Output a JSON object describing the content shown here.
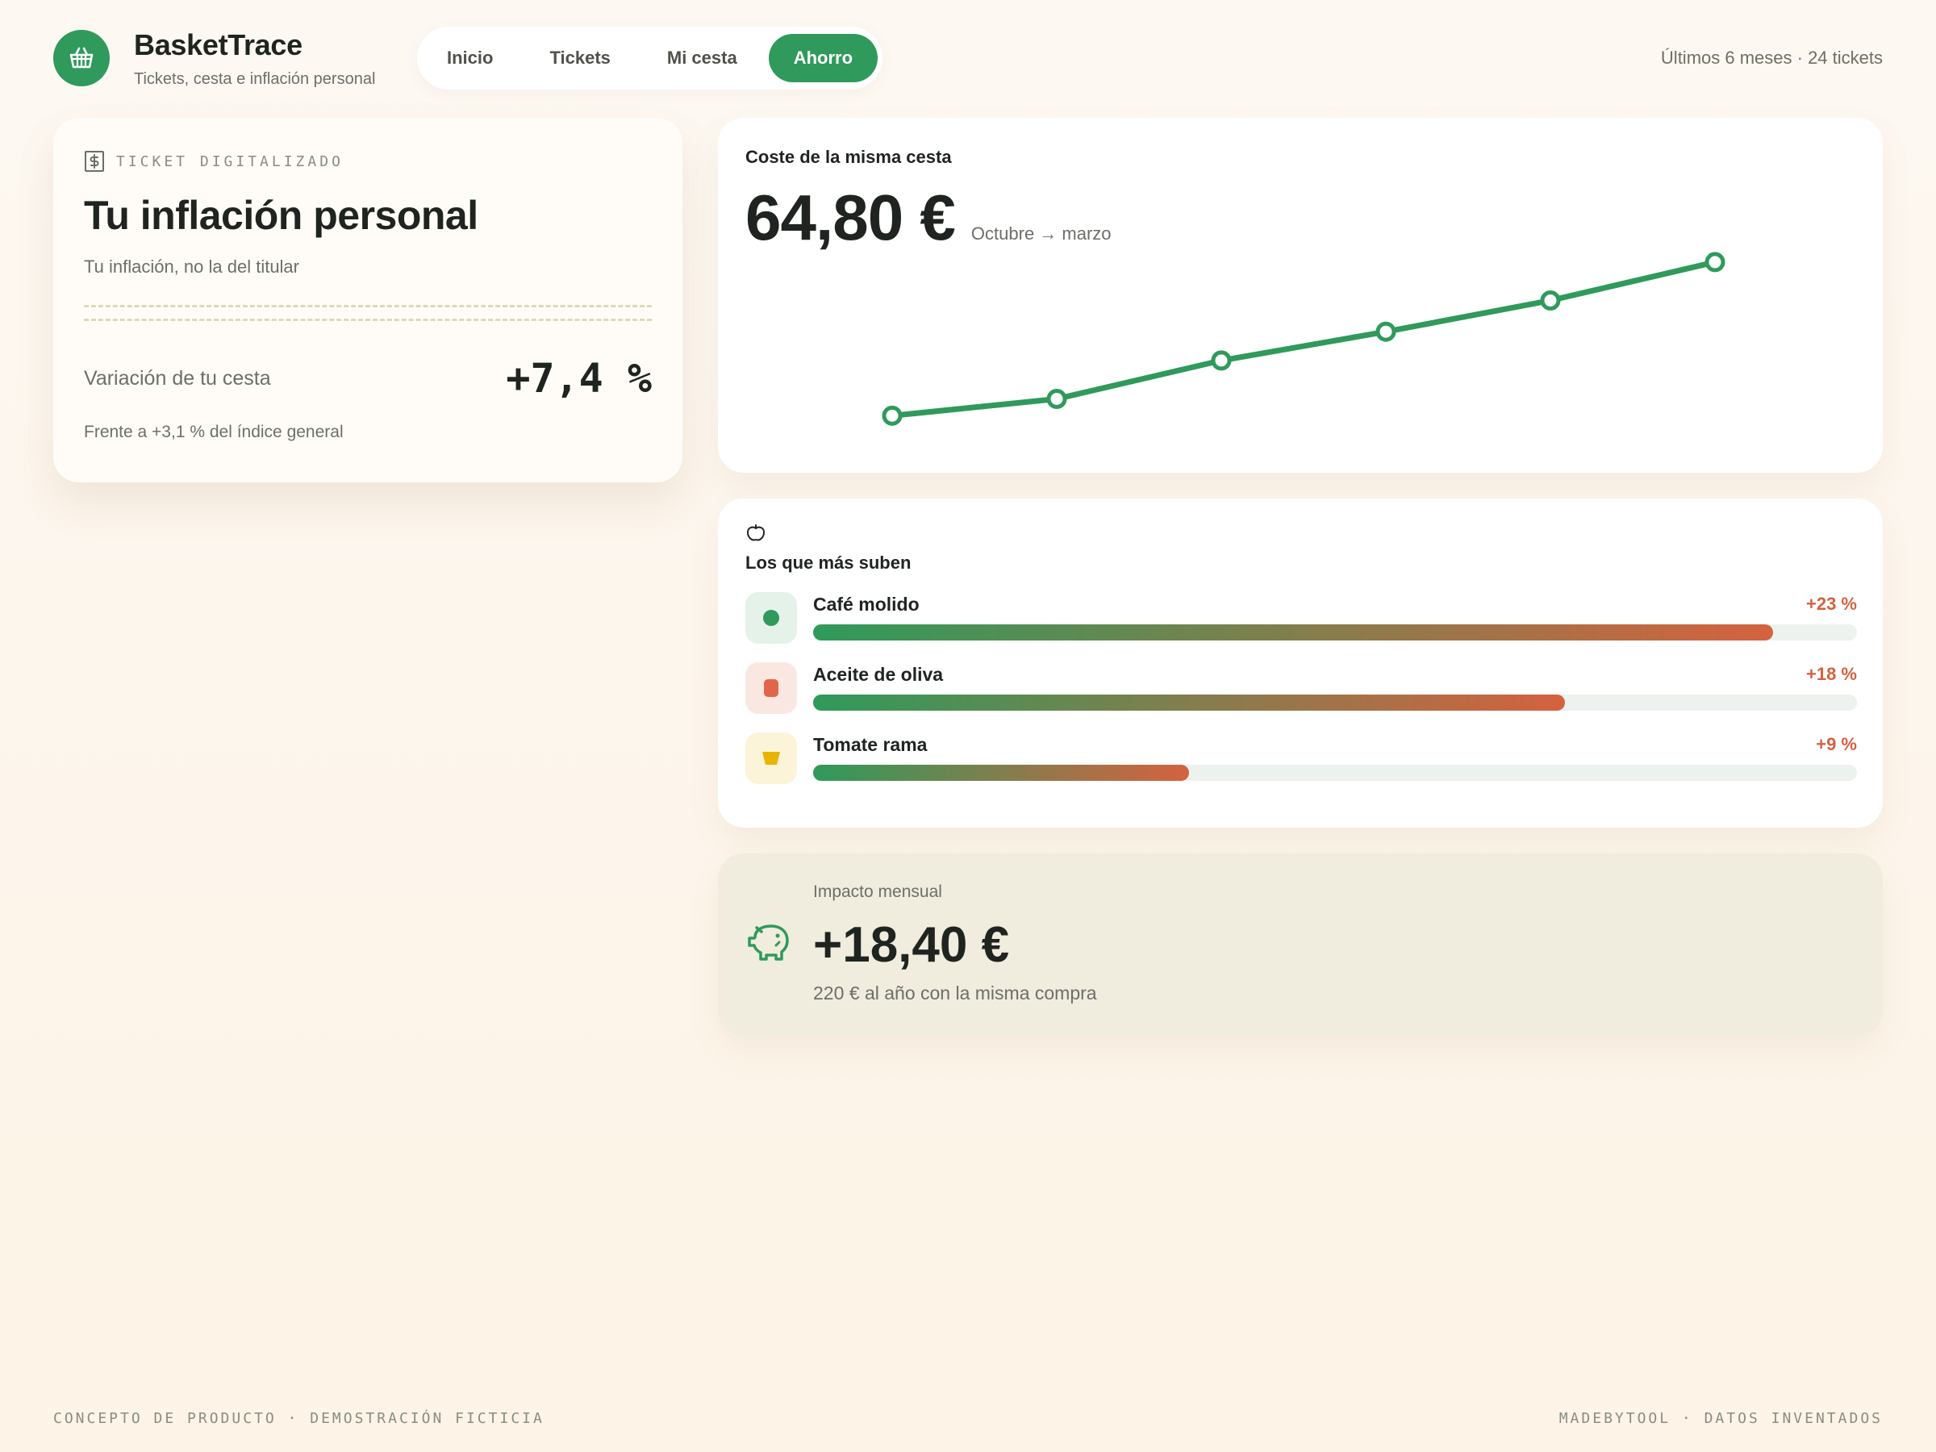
{
  "app": {
    "name": "BasketTrace",
    "subtitle": "Tickets, cesta e inflación personal",
    "logo_icon": "basket-icon",
    "accent_color": "#2f9a5b",
    "rise_color": "#d4623f"
  },
  "nav": {
    "tabs": [
      {
        "label": "Inicio",
        "active": false
      },
      {
        "label": "Tickets",
        "active": false
      },
      {
        "label": "Mi cesta",
        "active": false
      },
      {
        "label": "Ahorro",
        "active": true
      }
    ]
  },
  "header": {
    "meta": "Últimos 6 meses · 24 tickets"
  },
  "ticket": {
    "icon": "dollar-receipt-icon",
    "eyebrow": "TICKET DIGITALIZADO",
    "title": "Tu inflación personal",
    "subtitle": "Tu inflación, no la del titular",
    "variation_label": "Variación de tu cesta",
    "variation_value": "+7,4 %",
    "variation_note": "Frente a +3,1 % del índice general"
  },
  "cost": {
    "title": "Coste de la misma cesta",
    "value": "64,80 €",
    "period": "Octubre → marzo"
  },
  "chart_data": {
    "type": "line",
    "title": "Coste de la misma cesta",
    "x": [
      1,
      2,
      3,
      4,
      5,
      6
    ],
    "series": [
      {
        "values": [
          60.3,
          61.0,
          62.6,
          63.8,
          65.1,
          66.7
        ]
      }
    ],
    "ylim": [
      59.0,
      67.0
    ],
    "grid": false,
    "line_color": "#2f9a5b"
  },
  "risers": {
    "icon": "apple-icon",
    "title": "Los que más suben",
    "items": [
      {
        "name": "Café molido",
        "pct": "+23 %",
        "value": 23,
        "icon": "coffee-bean-icon",
        "icon_color": "#2f9a5b",
        "icon_bg": "#e4f2ea"
      },
      {
        "name": "Aceite de oliva",
        "pct": "+18 %",
        "value": 18,
        "icon": "oil-bottle-icon",
        "icon_color": "#e0664a",
        "icon_bg": "#fbe7e1"
      },
      {
        "name": "Tomate rama",
        "pct": "+9 %",
        "value": 9,
        "icon": "tomato-basket-icon",
        "icon_color": "#e9b400",
        "icon_bg": "#fcf4d9"
      }
    ]
  },
  "impact": {
    "icon": "piggy-bank-icon",
    "label": "Impacto mensual",
    "value": "+18,40 €",
    "note": "220 € al año con la misma compra"
  },
  "footer": {
    "left": "CONCEPTO DE PRODUCTO · DEMOSTRACIÓN FICTICIA",
    "right": "MADEBYTOOL · DATOS INVENTADOS"
  }
}
